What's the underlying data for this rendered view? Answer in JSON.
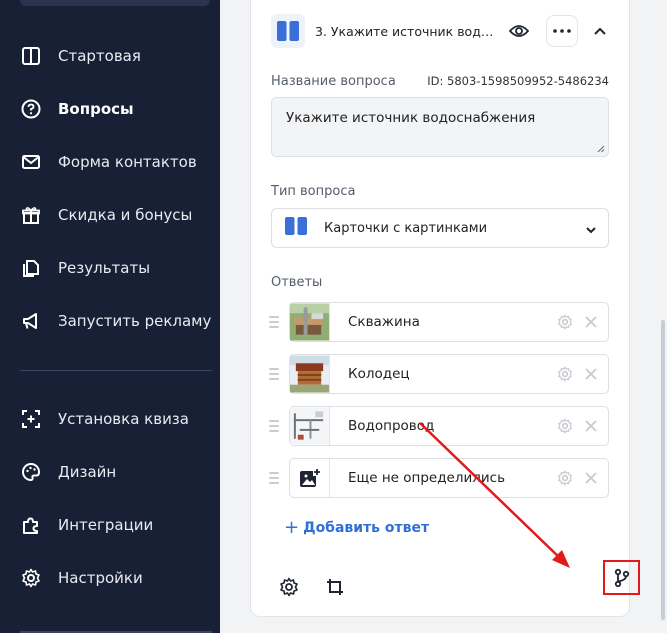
{
  "sidebar": {
    "items": [
      {
        "label": "Стартовая",
        "icon": "layout-icon",
        "active": false
      },
      {
        "label": "Вопросы",
        "icon": "question-circle-icon",
        "active": true
      },
      {
        "label": "Форма контактов",
        "icon": "envelope-icon",
        "active": false
      },
      {
        "label": "Скидка и бонусы",
        "icon": "gift-icon",
        "active": false
      },
      {
        "label": "Результаты",
        "icon": "pages-icon",
        "active": false
      },
      {
        "label": "Запустить рекламу",
        "icon": "megaphone-icon",
        "active": false
      },
      {
        "label": "Установка квиза",
        "icon": "install-frame-icon",
        "active": false
      },
      {
        "label": "Дизайн",
        "icon": "palette-icon",
        "active": false
      },
      {
        "label": "Интеграции",
        "icon": "puzzle-icon",
        "active": false
      },
      {
        "label": "Настройки",
        "icon": "gear-icon",
        "active": false
      }
    ]
  },
  "question": {
    "title": "3. Укажите источник водоснабжения",
    "name_label": "Название вопроса",
    "id_text": "ID: 5803-1598509952-5486234",
    "name_value": "Укажите источник водоснабжения",
    "type_label": "Тип вопроса",
    "type_value": "Карточки с картинками",
    "answers_label": "Ответы",
    "answers": [
      {
        "label": "Скважина",
        "thumb": "well-drilling-image"
      },
      {
        "label": "Колодец",
        "thumb": "log-well-image"
      },
      {
        "label": "Водопровод",
        "thumb": "water-pipes-image"
      },
      {
        "label": "Еще не определились",
        "thumb": "add-image-icon"
      }
    ],
    "add_answer": "Добавить ответ"
  },
  "colors": {
    "sidebar_bg": "#182035",
    "accent": "#2f6fd6",
    "highlight": "#e01b1b"
  }
}
